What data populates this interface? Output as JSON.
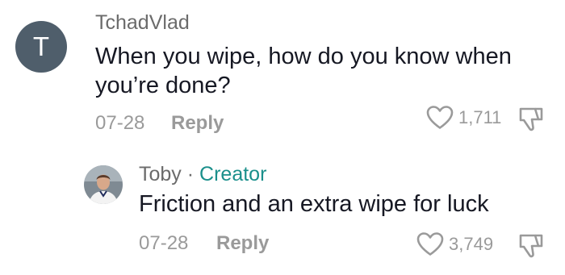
{
  "comment": {
    "avatar_letter": "T",
    "username": "TchadVlad",
    "text": "When you wipe, how do you know when you’re done?",
    "date": "07-28",
    "reply_label": "Reply",
    "likes": "1,711"
  },
  "reply_comment": {
    "username": "Toby",
    "separator": "·",
    "badge": "Creator",
    "text": "Friction and an extra wipe for luck",
    "date": "07-28",
    "reply_label": "Reply",
    "likes": "3,749"
  },
  "colors": {
    "avatar_bg": "#4f5e6b",
    "creator_badge": "#1a8f8b",
    "muted_text": "#9a9a9a",
    "body_text": "#161823"
  }
}
